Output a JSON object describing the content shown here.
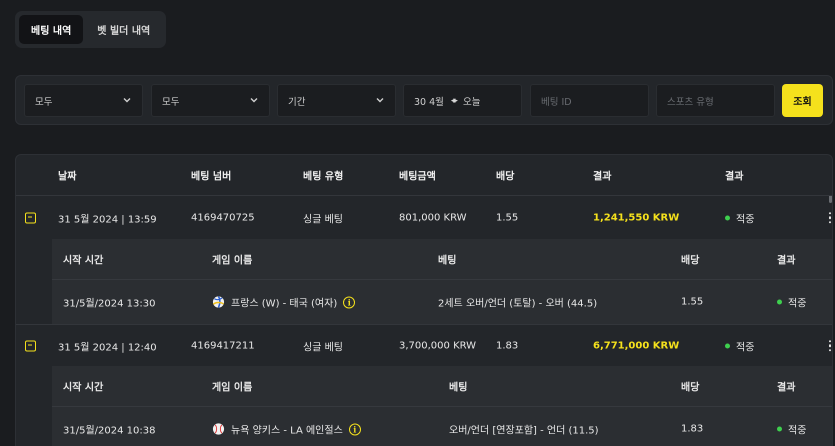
{
  "tabs": [
    {
      "label": "베팅 내역",
      "active": true
    },
    {
      "label": "벳 빌더 내역",
      "active": false
    }
  ],
  "filters": {
    "select1": "모두",
    "select2": "모두",
    "period": "기간",
    "date_from": "30 4월",
    "date_to": "오늘",
    "bet_id_placeholder": "베팅 ID",
    "sport_type_placeholder": "스포츠 유형",
    "search_label": "조회"
  },
  "table": {
    "headers": {
      "date": "날짜",
      "bet_number": "베팅 넘버",
      "bet_type": "베팅 유형",
      "bet_amount": "베팅금액",
      "odds": "배당",
      "result_amount": "결과",
      "result": "결과"
    },
    "sub_headers": {
      "start_time": "시작 시간",
      "game_name": "게임 이름",
      "bet": "베팅",
      "odds": "배당",
      "result": "결과"
    },
    "rows": [
      {
        "date": "31 5월 2024 | 13:59",
        "bet_number": "4169470725",
        "bet_type": "싱글 베팅",
        "bet_amount": "801,000 KRW",
        "odds": "1.55",
        "payout": "1,241,550 KRW",
        "result": "적중",
        "detail": {
          "start_time": "31/5월/2024 13:30",
          "sport_icon": "volleyball-icon",
          "game_name": "프랑스 (W) - 태국 (여자)",
          "bet": "2세트 오버/언더 (토탈) - 오버 (44.5)",
          "odds": "1.55",
          "result": "적중"
        }
      },
      {
        "date": "31 5월 2024 | 12:40",
        "bet_number": "4169417211",
        "bet_type": "싱글 베팅",
        "bet_amount": "3,700,000 KRW",
        "odds": "1.83",
        "payout": "6,771,000 KRW",
        "result": "적중",
        "detail": {
          "start_time": "31/5월/2024 10:38",
          "sport_icon": "baseball-icon",
          "game_name": "뉴욕 양키스 - LA 에인절스",
          "bet": "오버/언더 [연장포함] - 언더 (11.5)",
          "odds": "1.83",
          "result": "적중"
        }
      }
    ]
  },
  "colors": {
    "accent": "#f5e11c",
    "win": "#3ecf4e",
    "background": "#1a1c1f",
    "panel": "#23262a"
  }
}
